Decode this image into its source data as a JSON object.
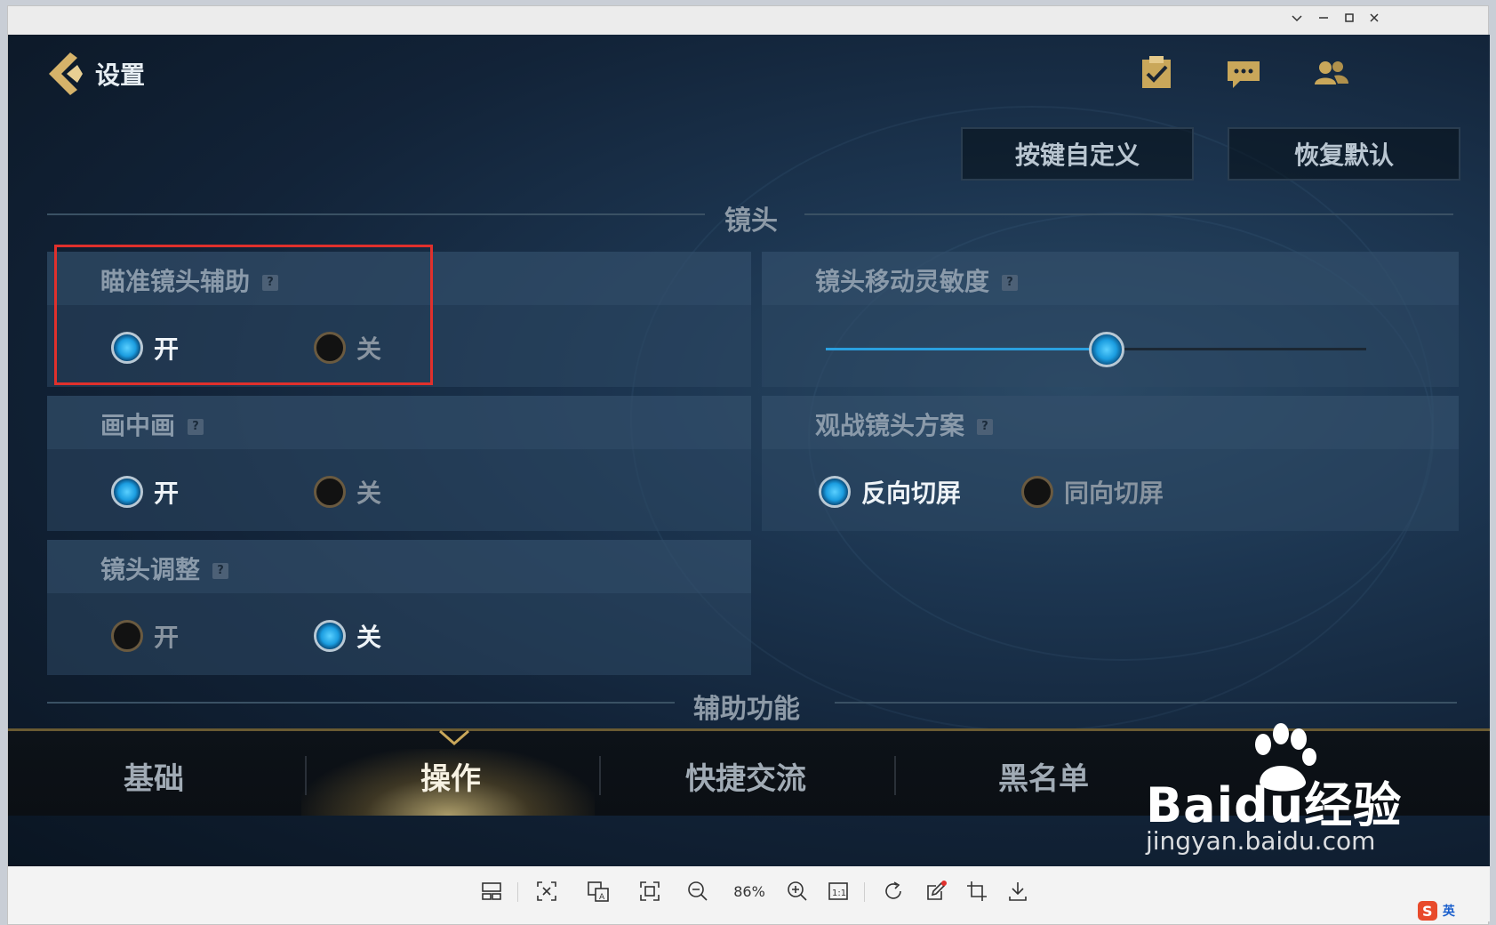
{
  "window": {
    "controls": [
      "chevron-down",
      "minimize",
      "maximize",
      "close"
    ]
  },
  "header": {
    "back_label": "设置",
    "icons": [
      "task-check-icon",
      "chat-icon",
      "friends-icon"
    ],
    "buttons": {
      "custom_keys": "按键自定义",
      "restore_default": "恢复默认"
    }
  },
  "section_camera": {
    "title": "镜头",
    "aim_assist": {
      "label": "瞄准镜头辅助",
      "on": "开",
      "off": "关",
      "selected": "on"
    },
    "sensitivity": {
      "label": "镜头移动灵敏度",
      "value_fraction": 0.52
    },
    "pip": {
      "label": "画中画",
      "on": "开",
      "off": "关",
      "selected": "on"
    },
    "spectate": {
      "label": "观战镜头方案",
      "opt1": "反向切屏",
      "opt2": "同向切屏",
      "selected": "opt1"
    },
    "adjust": {
      "label": "镜头调整",
      "on": "开",
      "off": "关",
      "selected": "off"
    }
  },
  "section_assist": {
    "title": "辅助功能"
  },
  "bottom_nav": {
    "tabs": [
      "基础",
      "操作",
      "快捷交流",
      "黑名单"
    ],
    "active": 1
  },
  "watermark": {
    "brand": "Baidu经验",
    "url": "jingyan.baidu.com"
  },
  "toolbar": {
    "zoom": "86%"
  },
  "ime": {
    "label": "英"
  },
  "colors": {
    "accent": "#2aa0e0",
    "highlight_box": "#e0302c",
    "gold": "#c9a75a"
  }
}
